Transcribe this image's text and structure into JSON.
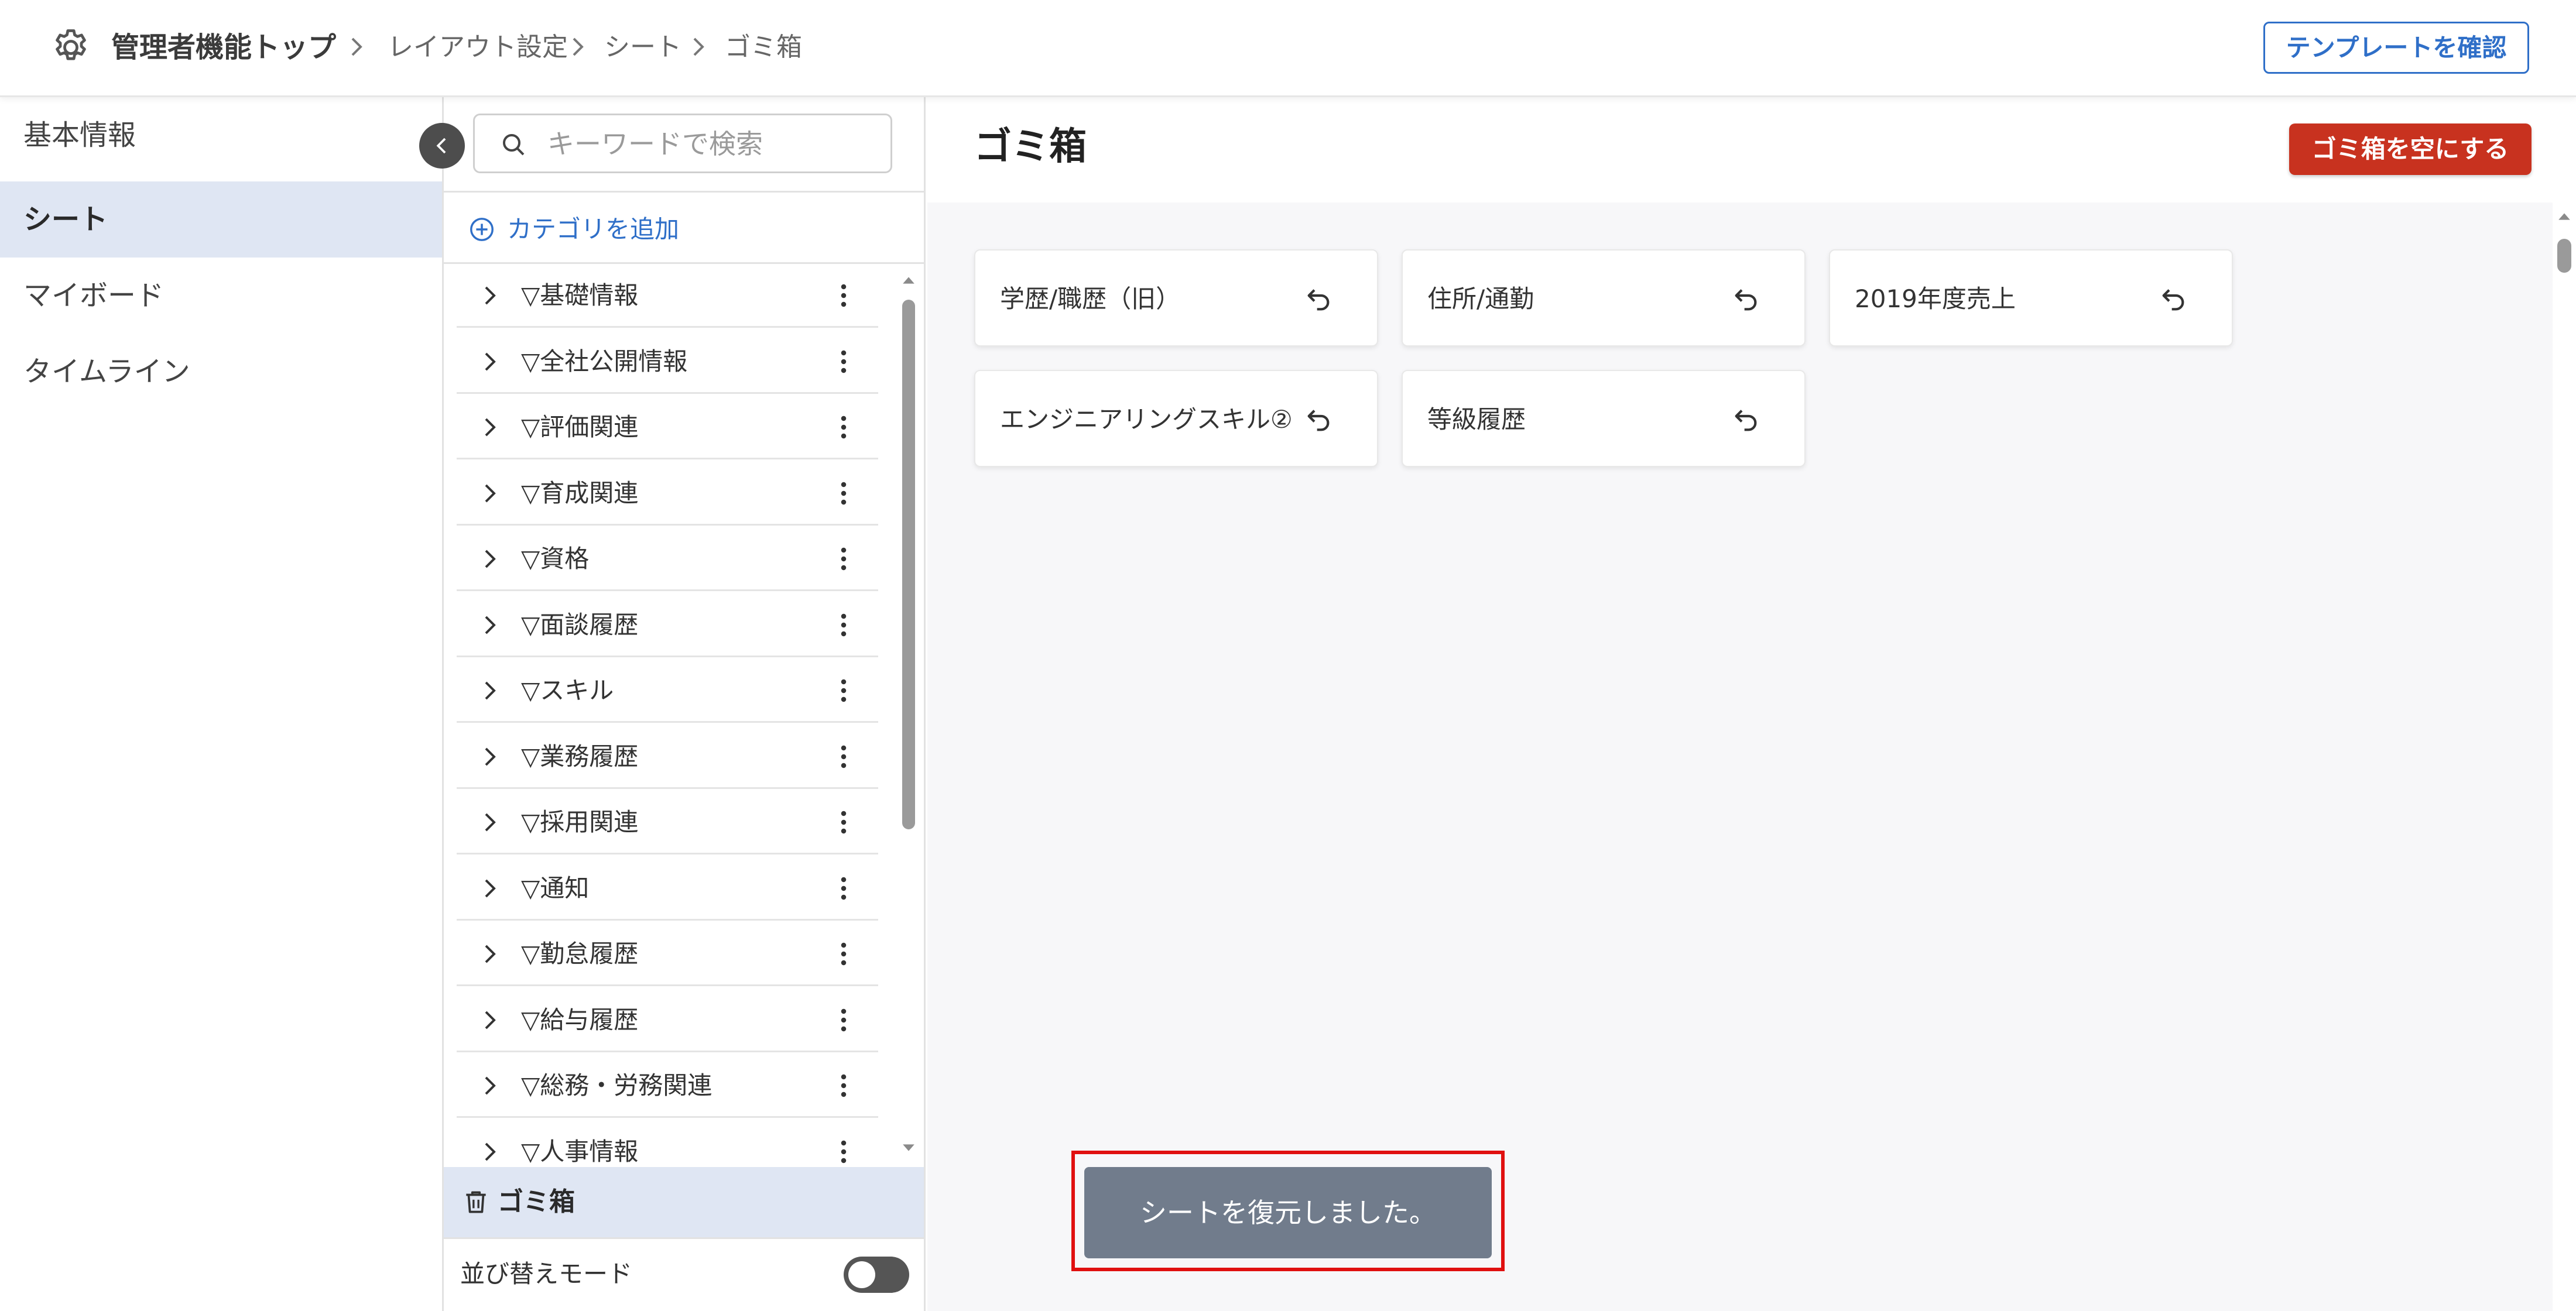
{
  "header": {
    "breadcrumb": {
      "root": "管理者機能トップ",
      "items": [
        "レイアウト設定",
        "シート",
        "ゴミ箱"
      ]
    },
    "template_button": "テンプレートを確認"
  },
  "left_nav": {
    "items": [
      {
        "label": "基本情報",
        "active": false
      },
      {
        "label": "シート",
        "active": true
      },
      {
        "label": "マイボード",
        "active": false
      },
      {
        "label": "タイムライン",
        "active": false
      }
    ]
  },
  "sheet_panel": {
    "search_placeholder": "キーワードで検索",
    "add_category": "カテゴリを追加",
    "categories": [
      "▽基礎情報",
      "▽全社公開情報",
      "▽評価関連",
      "▽育成関連",
      "▽資格",
      "▽面談履歴",
      "▽スキル",
      "▽業務履歴",
      "▽採用関連",
      "▽通知",
      "▽勤怠履歴",
      "▽給与履歴",
      "▽総務・労務関連",
      "▽人事情報"
    ],
    "trash_label": "ゴミ箱",
    "sort_mode_label": "並び替えモード",
    "sort_mode_on": false
  },
  "trash": {
    "title": "ゴミ箱",
    "empty_button": "ゴミ箱を空にする",
    "cards": [
      "学歴/職歴（旧）",
      "住所/通勤",
      "2019年度売上",
      "エンジニアリングスキル②",
      "等級履歴"
    ]
  },
  "toast": {
    "message": "シートを復元しました。"
  },
  "colors": {
    "accent": "#2f6fc8",
    "danger": "#c8321f",
    "active_bg": "#dfe6f3",
    "toast_bg": "#717c8c",
    "highlight": "#e01010"
  },
  "icons": [
    "gear-icon",
    "chevron-right-icon",
    "chevron-left-icon",
    "search-icon",
    "add-circle-icon",
    "more-vertical-icon",
    "trash-icon",
    "restore-icon"
  ]
}
